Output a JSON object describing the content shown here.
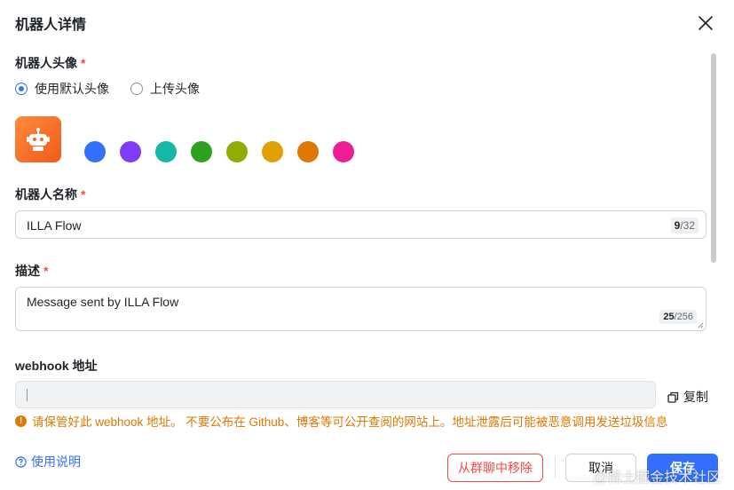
{
  "dialog": {
    "title": "机器人详情"
  },
  "avatar_section": {
    "label": "机器人头像",
    "required_mark": "*",
    "options": [
      {
        "label": "使用默认头像",
        "checked": true
      },
      {
        "label": "上传头像",
        "checked": false
      }
    ],
    "colors": [
      "#3370ff",
      "#7f3bf5",
      "#14b8a6",
      "#2ea121",
      "#8fac02",
      "#e0a200",
      "#de7802",
      "#f01d94"
    ],
    "avatar_icon": "robot-icon"
  },
  "name_section": {
    "label": "机器人名称",
    "required_mark": "*",
    "value": "ILLA Flow",
    "count_current": "9",
    "count_max": "/32"
  },
  "desc_section": {
    "label": "描述",
    "required_mark": "*",
    "value": "Message sent by ILLA Flow",
    "count_current": "25",
    "count_max": "/256"
  },
  "webhook_section": {
    "label": "webhook 地址",
    "value": "",
    "copy_label": "复制",
    "warning": "请保管好此 webhook 地址。 不要公布在 Github、博客等可公开查阅的网站上。地址泄露后可能被恶意调用发送垃圾信息"
  },
  "footer": {
    "help_label": "使用说明",
    "remove_label": "从群聊中移除",
    "cancel_label": "取消",
    "save_label": "保存"
  },
  "watermark": "@稀土掘金技术社区"
}
